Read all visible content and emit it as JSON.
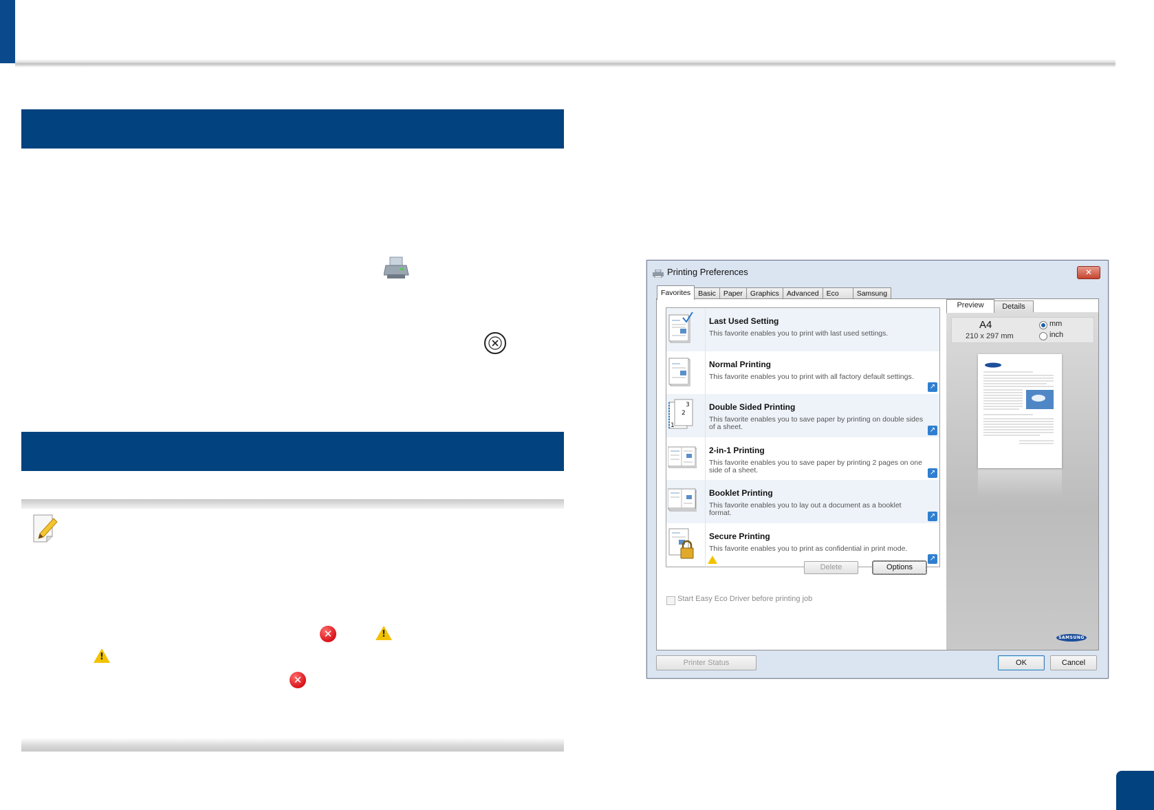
{
  "dialog": {
    "title": "Printing Preferences",
    "close_label": "✕",
    "tabs": [
      "Favorites",
      "Basic",
      "Paper",
      "Graphics",
      "Advanced",
      "Eco",
      "Samsung"
    ],
    "favorites": [
      {
        "title": "Last Used Setting",
        "desc": "This favorite enables you to print with last used settings."
      },
      {
        "title": "Normal Printing",
        "desc": "This favorite enables you to print with all factory default settings."
      },
      {
        "title": "Double Sided Printing",
        "desc": "This favorite enables you to save paper by printing on double sides of a sheet."
      },
      {
        "title": "2-in-1 Printing",
        "desc": "This favorite enables you to save paper by printing 2 pages on one side of a sheet."
      },
      {
        "title": "Booklet Printing",
        "desc": "This favorite enables you to lay out a document as a booklet format."
      },
      {
        "title": "Secure Printing",
        "desc": "This favorite enables you to print as confidential in print mode."
      }
    ],
    "delete_label": "Delete",
    "options_label": "Options",
    "eco_label": "Start Easy Eco Driver before printing job",
    "preview_tabs": {
      "preview": "Preview",
      "details": "Details"
    },
    "paper_size": "A4",
    "paper_dims": "210 x 297 mm",
    "units": {
      "mm": "mm",
      "inch": "inch",
      "selected": "mm"
    },
    "brand": "SAMSUNG",
    "printer_status_label": "Printer Status",
    "ok_label": "OK",
    "cancel_label": "Cancel"
  },
  "doc_icons": {
    "error": "error-icon",
    "warning": "warning-icon",
    "printer": "printer-icon",
    "cancel": "cancel-circle-icon",
    "note": "note-pencil-icon"
  },
  "colors": {
    "section_bar": "#02427e",
    "accent": "#0a4a8c",
    "error": "#d8141a",
    "warning": "#f2c200"
  }
}
